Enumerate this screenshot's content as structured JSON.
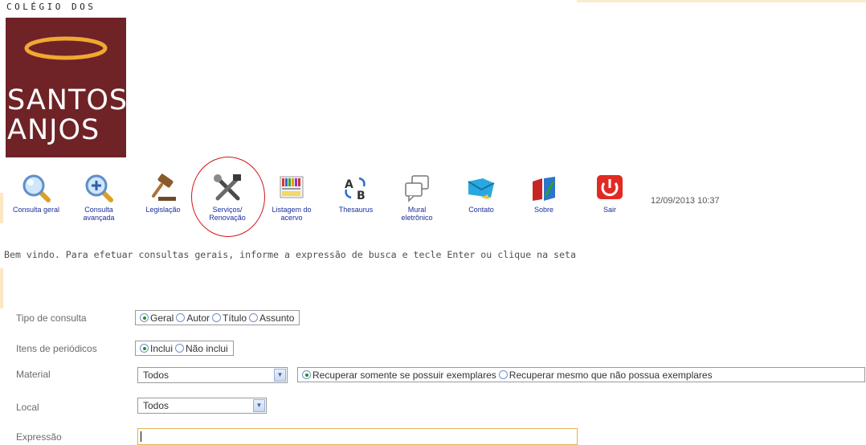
{
  "logo": {
    "top_text": "COLÉGIO DOS",
    "line1": "SANTOS",
    "line2": "ANJOS",
    "bg_color": "#6f2327",
    "halo_color": "#f0a832"
  },
  "toolbar": {
    "items": [
      {
        "label": "Consulta geral",
        "icon": "magnifier-icon"
      },
      {
        "label": "Consulta avançada",
        "icon": "magnifier-plus-icon"
      },
      {
        "label": "Legislação",
        "icon": "gavel-icon"
      },
      {
        "label": "Serviços/ Renovação",
        "icon": "tools-icon"
      },
      {
        "label": "Listagem do acervo",
        "icon": "bookshelf-icon"
      },
      {
        "label": "Thesaurus",
        "icon": "thesaurus-icon"
      },
      {
        "label": "Mural eletrônico",
        "icon": "chat-bubbles-icon"
      },
      {
        "label": "Contato",
        "icon": "envelope-icon"
      },
      {
        "label": "Sobre",
        "icon": "open-book-icon"
      },
      {
        "label": "Sair",
        "icon": "power-icon"
      }
    ],
    "datetime": "12/09/2013 10:37",
    "highlight_color": "#d3141a"
  },
  "welcome": "Bem vindo. Para efetuar consultas gerais, informe a expressão de busca e tecle Enter ou clique na seta",
  "form": {
    "tipo": {
      "label": "Tipo de consulta",
      "options": [
        "Geral",
        "Autor",
        "Título",
        "Assunto"
      ],
      "selected": "Geral"
    },
    "itens": {
      "label": "Itens de periódicos",
      "options": [
        "Inclui",
        "Não inclui"
      ],
      "selected": "Inclui"
    },
    "material": {
      "label": "Material",
      "value": "Todos",
      "options": [
        "Recuperar somente se possuir exemplares",
        "Recuperar mesmo que não possua exemplares"
      ],
      "selected": "Recuperar somente se possuir exemplares"
    },
    "local": {
      "label": "Local",
      "value": "Todos"
    },
    "expressao": {
      "label": "Expressão",
      "value": ""
    }
  }
}
